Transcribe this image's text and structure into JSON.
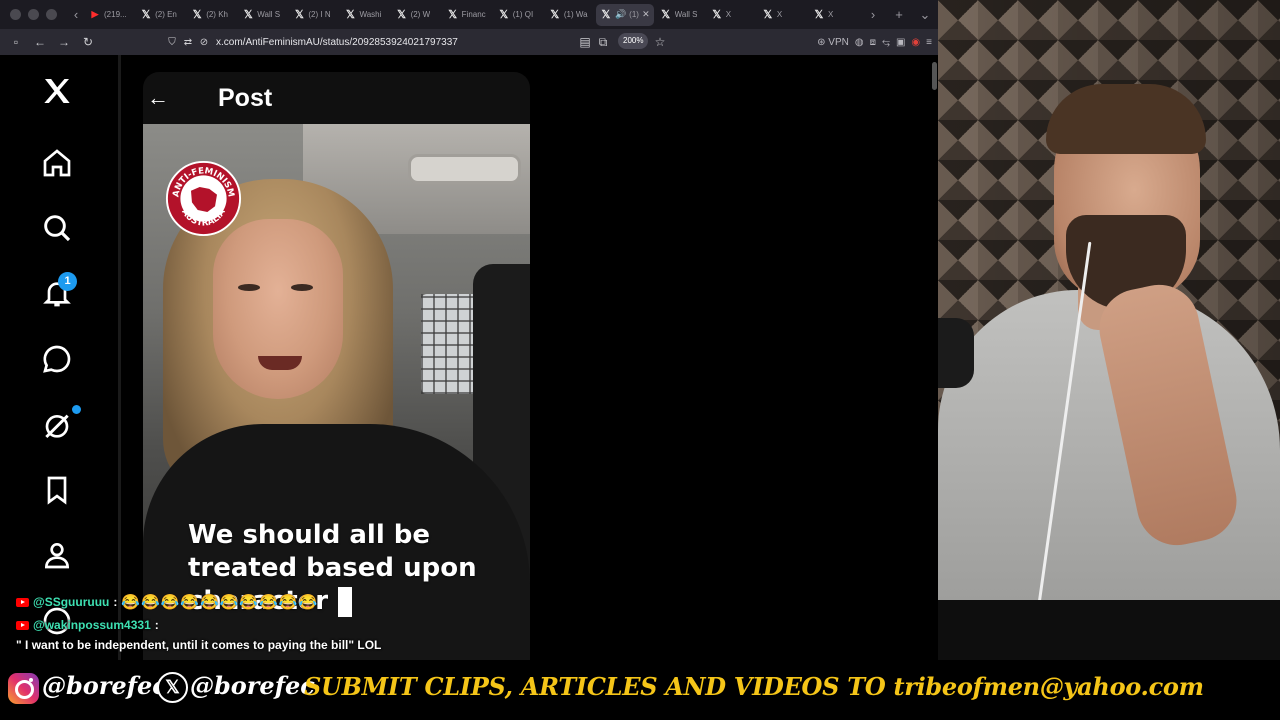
{
  "browser": {
    "tabs": [
      {
        "label": "(219...",
        "icon": "youtube-icon"
      },
      {
        "label": "(2) En",
        "icon": "x-logo-icon"
      },
      {
        "label": "(2) Kh",
        "icon": "x-logo-icon"
      },
      {
        "label": "Wall S",
        "icon": "x-logo-icon"
      },
      {
        "label": "(2) I N",
        "icon": "x-logo-icon"
      },
      {
        "label": "Washi",
        "icon": "x-logo-icon"
      },
      {
        "label": "(2) W",
        "icon": "x-logo-icon"
      },
      {
        "label": "Financ",
        "icon": "x-logo-icon"
      },
      {
        "label": "(1) QI",
        "icon": "x-logo-icon"
      },
      {
        "label": "(1) Wa",
        "icon": "x-logo-icon"
      },
      {
        "label": "(1)",
        "icon": "x-logo-icon",
        "active": true
      },
      {
        "label": "Wall S",
        "icon": "x-logo-icon"
      },
      {
        "label": "X",
        "icon": "x-logo-icon"
      },
      {
        "label": "X",
        "icon": "x-logo-icon"
      },
      {
        "label": "X",
        "icon": "x-logo-icon"
      }
    ],
    "url": "x.com/AntiFeminismAU/status/2092853924021797337",
    "zoom": "200%",
    "vpn_label": "VPN"
  },
  "sidebar": {
    "notification_count": "1",
    "items": [
      "x-logo-icon",
      "home-icon",
      "search-icon",
      "notifications-icon",
      "messages-icon",
      "grok-icon",
      "bookmarks-icon",
      "profile-icon"
    ]
  },
  "post": {
    "title": "Post",
    "logo_text_top": "ANTI-FEMINISM",
    "logo_text_bottom": "AUSTRALIA",
    "caption_lines": [
      "We should all be",
      "treated based upon",
      "character"
    ]
  },
  "chat": [
    {
      "user": "@SSguuruuu",
      "message": "😂😂😂😂😂😂😂😂😂😂"
    },
    {
      "user": "@wakinpossum4331",
      "message": "\" I want to be independent, until it comes to paying the bill\" LOL"
    }
  ],
  "footer": {
    "instagram_handle": "@borefec",
    "x_handle": "@borefec",
    "cta": "SUBMIT CLIPS, ARTICLES AND VIDEOS TO tribeofmen@yahoo.com"
  },
  "colors": {
    "accent_blue": "#1d9bf0",
    "chat_user": "#3ee0b2",
    "cta_yellow": "#f5c518"
  }
}
